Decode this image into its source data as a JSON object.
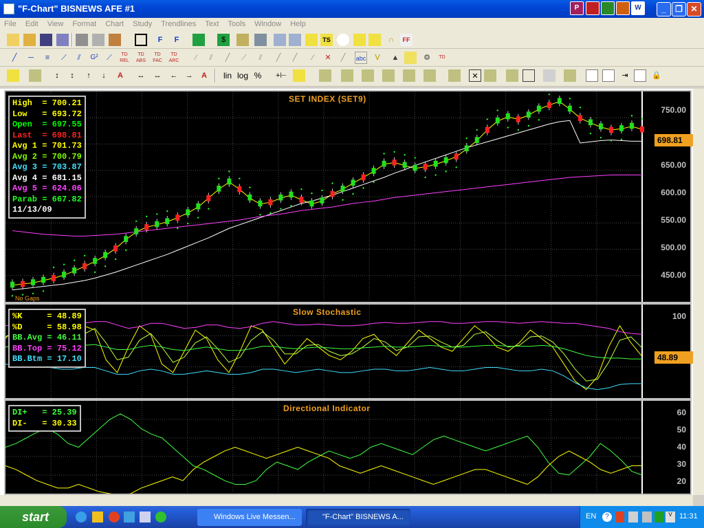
{
  "window": {
    "title": "\"F-Chart\" BISNEWS AFE #1",
    "titlebar_icons": [
      "P",
      "",
      "",
      "",
      "W"
    ]
  },
  "menu": [
    "File",
    "Edit",
    "View",
    "Format",
    "Chart",
    "Study",
    "Trendlines",
    "Text",
    "Tools",
    "Window",
    "Help"
  ],
  "toolbar2": {
    "td_labels": [
      "TD REL",
      "TD ABS",
      "TD FAC",
      "TD ARC"
    ]
  },
  "toolbar3": {
    "lin_label": "lin",
    "log_label": "log",
    "pct_label": "%"
  },
  "price_panel": {
    "title": "SET INDEX (SET9)",
    "info": [
      {
        "label": "High  ",
        "value": "700.21",
        "color": "#ffff00"
      },
      {
        "label": "Low   ",
        "value": "693.72",
        "color": "#ffff00"
      },
      {
        "label": "Open  ",
        "value": "697.55",
        "color": "#00ff00"
      },
      {
        "label": "Last  ",
        "value": "698.81",
        "color": "#ff2020"
      },
      {
        "label": "Avg 1 ",
        "value": "701.73",
        "color": "#ffff00"
      },
      {
        "label": "Avg 2 ",
        "value": "700.79",
        "color": "#80ff00"
      },
      {
        "label": "Avg 3 ",
        "value": "703.87",
        "color": "#40e0ff"
      },
      {
        "label": "Avg 4 ",
        "value": "681.15",
        "color": "#ffffff"
      },
      {
        "label": "Avg 5 ",
        "value": "624.06",
        "color": "#ff40ff"
      },
      {
        "label": "Parab ",
        "value": "667.82",
        "color": "#20ff20"
      }
    ],
    "date": "11/13/09",
    "no_gaps": "No Gaps",
    "axis": [
      "750.00",
      "700.00",
      "650.00",
      "600.00",
      "550.00",
      "500.00",
      "450.00"
    ],
    "last_tag": "698.81"
  },
  "stoch_panel": {
    "title": "Slow  Stochastic",
    "info": [
      {
        "label": "%K     ",
        "value": "48.89",
        "color": "#ffff00"
      },
      {
        "label": "%D     ",
        "value": "58.98",
        "color": "#ffff00"
      },
      {
        "label": "BB.Avg ",
        "value": "46.11",
        "color": "#40ff40"
      },
      {
        "label": "BB.Top ",
        "value": "75.12",
        "color": "#ff40ff"
      },
      {
        "label": "BB.Btm ",
        "value": "17.10",
        "color": "#40e0ff"
      }
    ],
    "axis": [
      "100"
    ],
    "last_tag": "48.89"
  },
  "di_panel": {
    "title": "Directional  Indicator",
    "info": [
      {
        "label": "DI+   ",
        "value": "25.39",
        "color": "#40ff40"
      },
      {
        "label": "DI-   ",
        "value": "30.33",
        "color": "#ffff00"
      }
    ],
    "axis": [
      "60",
      "50",
      "40",
      "30",
      "20"
    ]
  },
  "taskbar": {
    "start": "start",
    "tasks": [
      "Windows Live Messen...",
      "\"F-Chart\" BISNEWS A..."
    ],
    "lang": "EN",
    "clock": "11:31"
  },
  "chart_data": [
    {
      "type": "candlestick",
      "title": "SET INDEX (SET9)",
      "ylim": [
        410,
        765
      ],
      "series": [
        {
          "name": "Avg 1",
          "values": [
            438,
            440,
            442,
            446,
            450,
            455,
            462,
            470,
            478,
            488,
            500,
            515,
            528,
            536,
            540,
            545,
            552,
            560,
            570,
            585,
            600,
            612,
            600,
            585,
            575,
            578,
            585,
            590,
            582,
            575,
            580,
            592,
            600,
            610,
            620,
            630,
            642,
            645,
            640,
            635,
            638,
            642,
            648,
            655,
            668,
            682,
            700,
            715,
            722,
            718,
            725,
            735,
            742,
            748,
            735,
            720,
            712,
            705,
            700,
            702,
            706,
            701
          ]
        },
        {
          "name": "Avg 4",
          "values": [
            430,
            432,
            434,
            436,
            438,
            440,
            443,
            446,
            450,
            455,
            460,
            466,
            472,
            478,
            484,
            490,
            497,
            504,
            511,
            518,
            526,
            534,
            540,
            546,
            552,
            558,
            564,
            570,
            576,
            580,
            585,
            590,
            596,
            602,
            608,
            614,
            620,
            627,
            633,
            640,
            646,
            652,
            658,
            664,
            670,
            675,
            680,
            685,
            690,
            695,
            700,
            705,
            710,
            714,
            716,
            678,
            680,
            682,
            683,
            682,
            681,
            681
          ]
        },
        {
          "name": "Avg 5",
          "values": [
            530,
            528,
            526,
            524,
            523,
            522,
            521,
            521,
            522,
            523,
            524,
            526,
            528,
            530,
            532,
            534,
            536,
            538,
            540,
            542,
            544,
            546,
            548,
            551,
            554,
            556,
            558,
            561,
            564,
            566,
            568,
            570,
            573,
            576,
            578,
            580,
            583,
            586,
            588,
            590,
            592,
            594,
            596,
            598,
            600,
            602,
            604,
            606,
            608,
            610,
            612,
            614,
            616,
            618,
            620,
            621,
            622,
            623,
            624,
            624,
            624,
            624
          ]
        }
      ]
    },
    {
      "type": "line",
      "title": "Slow Stochastic",
      "ylim": [
        0,
        110
      ],
      "series": [
        {
          "name": "%K",
          "values": [
            70,
            85,
            90,
            80,
            60,
            40,
            70,
            85,
            80,
            45,
            30,
            60,
            85,
            75,
            40,
            30,
            55,
            80,
            70,
            45,
            30,
            55,
            85,
            80,
            60,
            40,
            55,
            70,
            60,
            50,
            45,
            55,
            70,
            75,
            60,
            50,
            65,
            80,
            70,
            60,
            55,
            70,
            85,
            75,
            60,
            55,
            65,
            80,
            70,
            60,
            40,
            20,
            10,
            25,
            60,
            85,
            65,
            49
          ]
        },
        {
          "name": "%D",
          "values": [
            72,
            80,
            85,
            82,
            70,
            55,
            60,
            75,
            82,
            65,
            45,
            48,
            68,
            76,
            60,
            42,
            48,
            65,
            72,
            58,
            42,
            48,
            68,
            78,
            68,
            52,
            52,
            62,
            63,
            55,
            50,
            52,
            60,
            70,
            66,
            56,
            60,
            72,
            73,
            66,
            60,
            62,
            75,
            78,
            68,
            60,
            62,
            72,
            73,
            66,
            52,
            34,
            20,
            22,
            42,
            68,
            72,
            59
          ]
        },
        {
          "name": "BB.Avg",
          "values": [
            60,
            62,
            64,
            63,
            62,
            60,
            60,
            62,
            63,
            60,
            57,
            57,
            60,
            62,
            60,
            57,
            56,
            58,
            60,
            58,
            56,
            56,
            58,
            61,
            61,
            59,
            58,
            59,
            60,
            59,
            58,
            58,
            59,
            60,
            61,
            60,
            60,
            61,
            62,
            61,
            60,
            60,
            61,
            62,
            62,
            61,
            61,
            61,
            62,
            61,
            58,
            54,
            50,
            48,
            47,
            47,
            46,
            46
          ]
        },
        {
          "name": "BB.Top",
          "values": [
            85,
            87,
            90,
            90,
            90,
            88,
            86,
            88,
            90,
            90,
            86,
            82,
            84,
            88,
            88,
            85,
            82,
            83,
            86,
            86,
            83,
            82,
            84,
            88,
            90,
            88,
            86,
            86,
            87,
            86,
            85,
            85,
            86,
            88,
            89,
            88,
            88,
            89,
            90,
            90,
            88,
            88,
            89,
            90,
            90,
            89,
            88,
            89,
            90,
            89,
            88,
            88,
            86,
            84,
            82,
            78,
            76,
            75
          ]
        },
        {
          "name": "BB.Btm",
          "values": [
            40,
            38,
            36,
            36,
            36,
            34,
            34,
            36,
            36,
            32,
            28,
            28,
            32,
            34,
            32,
            28,
            28,
            30,
            32,
            30,
            28,
            28,
            30,
            34,
            34,
            32,
            30,
            32,
            34,
            32,
            30,
            30,
            32,
            34,
            34,
            32,
            32,
            34,
            36,
            34,
            32,
            32,
            34,
            36,
            36,
            34,
            32,
            32,
            34,
            32,
            26,
            18,
            12,
            10,
            12,
            16,
            17,
            17
          ]
        }
      ]
    },
    {
      "type": "line",
      "title": "Directional Indicator",
      "ylim": [
        15,
        65
      ],
      "series": [
        {
          "name": "DI+",
          "values": [
            40,
            42,
            45,
            48,
            50,
            47,
            42,
            40,
            45,
            50,
            55,
            58,
            55,
            50,
            47,
            45,
            40,
            35,
            30,
            28,
            25,
            22,
            20,
            20,
            22,
            28,
            32,
            30,
            28,
            32,
            35,
            38,
            36,
            34,
            36,
            40,
            42,
            40,
            38,
            36,
            40,
            44,
            46,
            44,
            42,
            40,
            38,
            40,
            42,
            44,
            46,
            40,
            32,
            26,
            25,
            30,
            35,
            42,
            38,
            33,
            27,
            25
          ]
        },
        {
          "name": "DI-",
          "values": [
            30,
            28,
            25,
            22,
            20,
            18,
            18,
            20,
            18,
            16,
            15,
            14,
            15,
            18,
            20,
            22,
            24,
            22,
            28,
            32,
            35,
            38,
            40,
            38,
            36,
            34,
            36,
            38,
            40,
            38,
            36,
            34,
            30,
            28,
            26,
            28,
            30,
            28,
            26,
            24,
            22,
            20,
            22,
            24,
            26,
            28,
            28,
            26,
            24,
            22,
            20,
            24,
            30,
            35,
            38,
            35,
            32,
            28,
            26,
            28,
            30,
            30
          ]
        }
      ]
    }
  ]
}
